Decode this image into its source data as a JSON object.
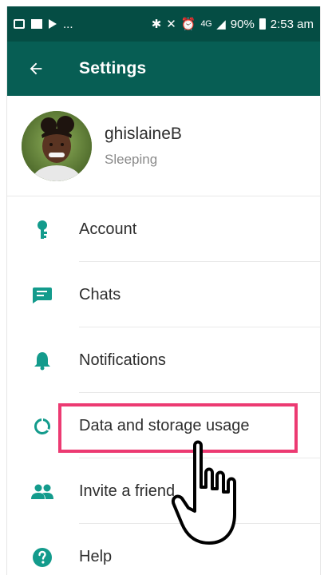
{
  "status_bar": {
    "left_more": "...",
    "battery": "90%",
    "time": "2:53 am",
    "network_small": "4G"
  },
  "app_bar": {
    "title": "Settings",
    "back_icon": "arrow-left-icon"
  },
  "profile": {
    "name": "ghislaineB",
    "status": "Sleeping"
  },
  "settings": {
    "items": [
      {
        "label": "Account",
        "icon": "key-icon"
      },
      {
        "label": "Chats",
        "icon": "chat-icon"
      },
      {
        "label": "Notifications",
        "icon": "bell-icon"
      },
      {
        "label": "Data and storage usage",
        "icon": "data-usage-icon"
      },
      {
        "label": "Invite a friend",
        "icon": "people-icon"
      },
      {
        "label": "Help",
        "icon": "help-icon"
      }
    ]
  },
  "colors": {
    "status_bar": "#054d44",
    "app_bar": "#075e54",
    "icon_teal": "#139b8c",
    "highlight": "#ec3a72"
  }
}
